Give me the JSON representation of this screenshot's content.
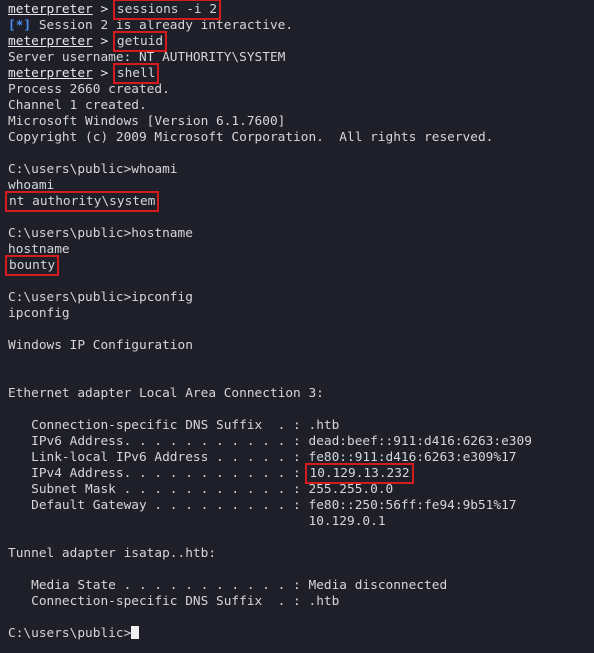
{
  "terminal": {
    "prompt_name": "meterpreter",
    "prompt_sep": " > ",
    "cmd_sessions": "sessions -i 2",
    "info_bracket": "[*]",
    "msg_already_interactive": " Session 2 is already interactive.",
    "cmd_getuid": "getuid",
    "server_username": "Server username: NT AUTHORITY\\SYSTEM",
    "cmd_shell": "shell",
    "process_created": "Process 2660 created.",
    "channel_created": "Channel 1 created.",
    "windows_version": "Microsoft Windows [Version 6.1.7600]",
    "copyright": "Copyright (c) 2009 Microsoft Corporation.  All rights reserved.",
    "prompt_cwd": "C:\\users\\public>",
    "cmd_whoami": "whoami",
    "echo_whoami": "whoami",
    "whoami_result": "nt authority\\system",
    "cmd_hostname": "hostname",
    "echo_hostname": "hostname",
    "hostname_result": "bounty",
    "cmd_ipconfig": "ipconfig",
    "echo_ipconfig": "ipconfig",
    "ip_config_title": "Windows IP Configuration",
    "eth_adapter_header": "Ethernet adapter Local Area Connection 3:",
    "dns_suffix_label": "   Connection-specific DNS Suffix  . : ",
    "dns_suffix_value": ".htb",
    "ipv6_label": "   IPv6 Address. . . . . . . . . . . : ",
    "ipv6_value": "dead:beef::911:d416:6263:e309",
    "linklocal_label": "   Link-local IPv6 Address . . . . . : ",
    "linklocal_value": "fe80::911:d416:6263:e309%17",
    "ipv4_label": "   IPv4 Address. . . . . . . . . . . : ",
    "ipv4_value": "10.129.13.232",
    "subnet_label": "   Subnet Mask . . . . . . . . . . . : ",
    "subnet_value": "255.255.0.0",
    "gateway_label": "   Default Gateway . . . . . . . . . : ",
    "gateway_value_1": "fe80::250:56ff:fe94:9b51%17",
    "gateway_indent": "                                       ",
    "gateway_value_2": "10.129.0.1",
    "tunnel_adapter_header": "Tunnel adapter isatap..htb:",
    "media_state_label": "   Media State . . . . . . . . . . . : ",
    "media_state_value": "Media disconnected",
    "tunnel_dns_label": "   Connection-specific DNS Suffix  . : ",
    "tunnel_dns_value": ".htb",
    "final_prompt": "C:\\users\\public>"
  },
  "colors": {
    "background": "#1e1f29",
    "text": "#d6d6d6",
    "info_blue": "#4a8df0",
    "highlight_red": "#d41c1c"
  }
}
